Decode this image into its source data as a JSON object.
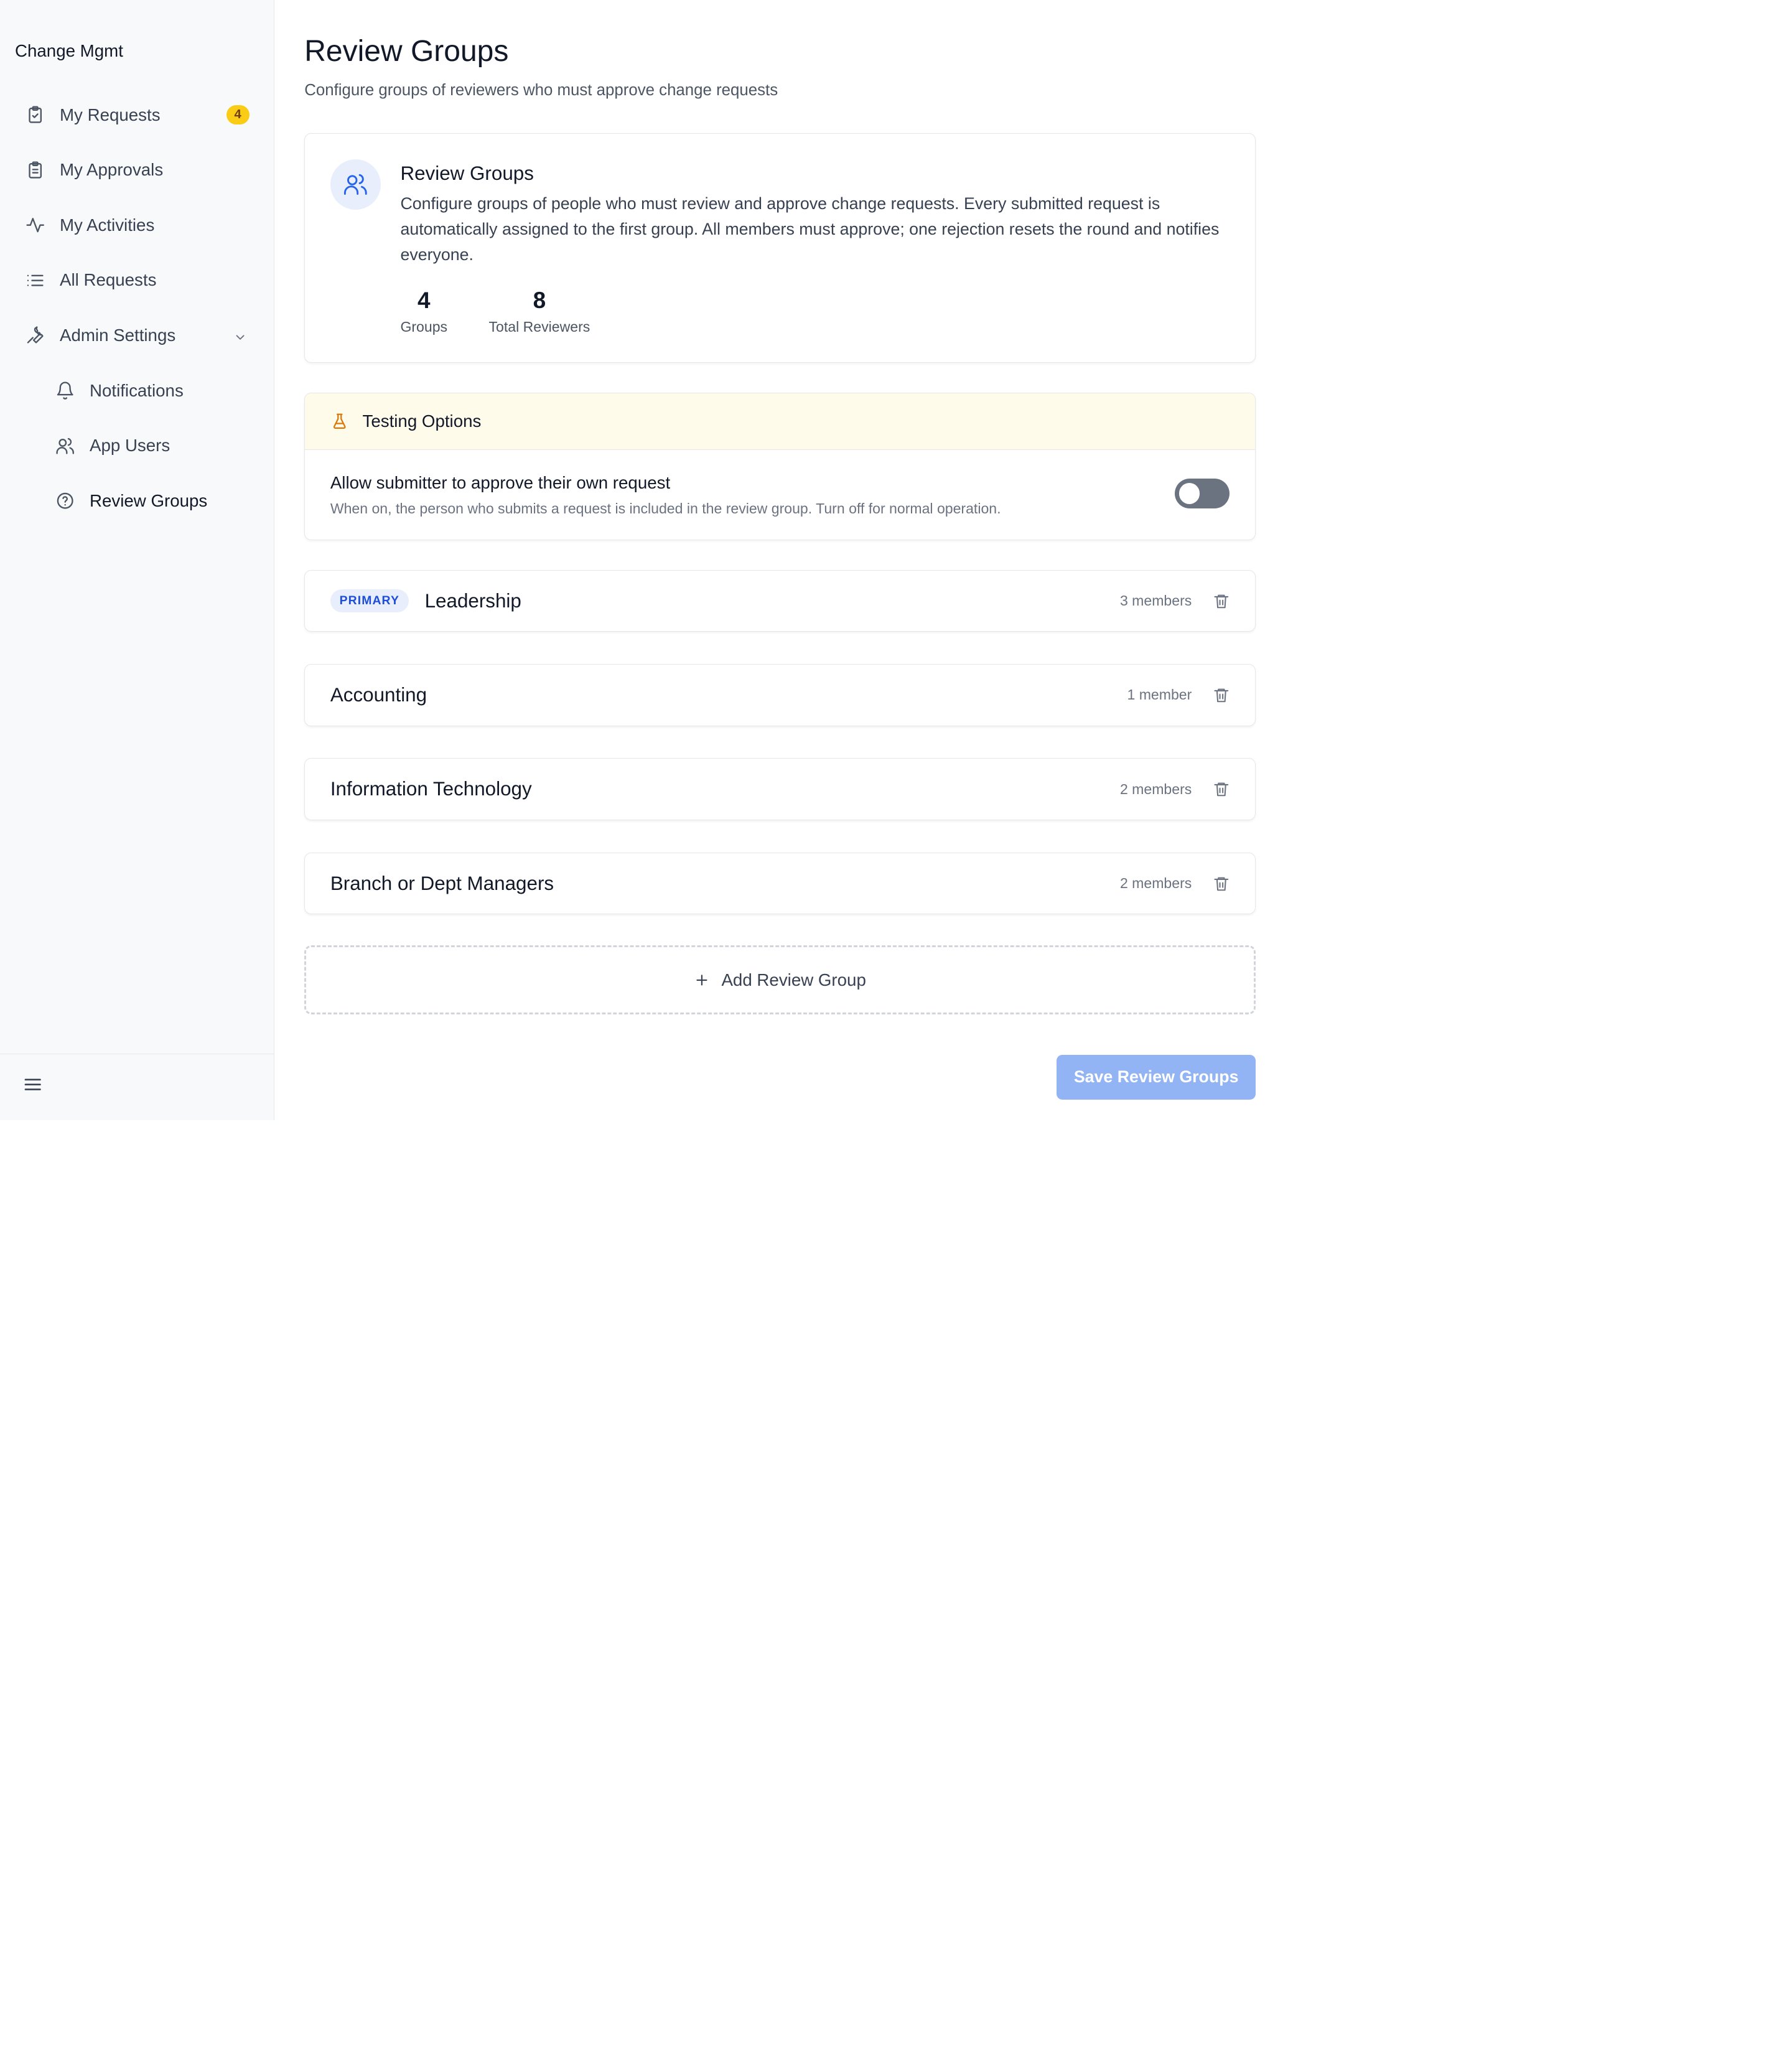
{
  "app": {
    "brand": "Change Mgmt"
  },
  "sidebar": {
    "items": [
      {
        "label": "My Requests",
        "icon": "clipboard-check-icon",
        "badge": "4"
      },
      {
        "label": "My Approvals",
        "icon": "clipboard-list-icon"
      },
      {
        "label": "My Activities",
        "icon": "activity-icon"
      },
      {
        "label": "All Requests",
        "icon": "list-icon"
      },
      {
        "label": "Admin Settings",
        "icon": "wrench-icon",
        "expanded": true
      },
      {
        "label": "Notifications",
        "icon": "bell-icon"
      },
      {
        "label": "App Users",
        "icon": "users-icon"
      },
      {
        "label": "Review Groups",
        "icon": "help-circle-icon",
        "active": true
      }
    ],
    "footer_icon": "menu-icon"
  },
  "page": {
    "title": "Review Groups",
    "subtitle": "Configure groups of reviewers who must approve change requests"
  },
  "info": {
    "icon": "users-icon",
    "title": "Review Groups",
    "description": "Configure groups of people who must review and approve change requests. Every submitted request is automatically assigned to the first group. All members must approve; one rejection resets the round and notifies everyone.",
    "stats": [
      {
        "value": "4",
        "label": "Groups"
      },
      {
        "value": "8",
        "label": "Total Reviewers"
      }
    ]
  },
  "testing": {
    "icon": "flask-icon",
    "title": "Testing Options",
    "option_label": "Allow submitter to approve their own request",
    "option_help": "When on, the person who submits a request is included in the review group. Turn off for normal operation.",
    "enabled": false
  },
  "groups": [
    {
      "tag": "PRIMARY",
      "name": "Leadership",
      "count": "3 members"
    },
    {
      "name": "Accounting",
      "count": "1 member"
    },
    {
      "name": "Information Technology",
      "count": "2 members"
    },
    {
      "name": "Branch or Dept Managers",
      "count": "2 members"
    }
  ],
  "actions": {
    "add_label": "Add Review Group",
    "save_label": "Save Review Groups"
  },
  "colors": {
    "accent": "#2563eb",
    "badge": "#facc15",
    "save_button": "#93b4f4",
    "testing_header": "#fffbeb"
  }
}
